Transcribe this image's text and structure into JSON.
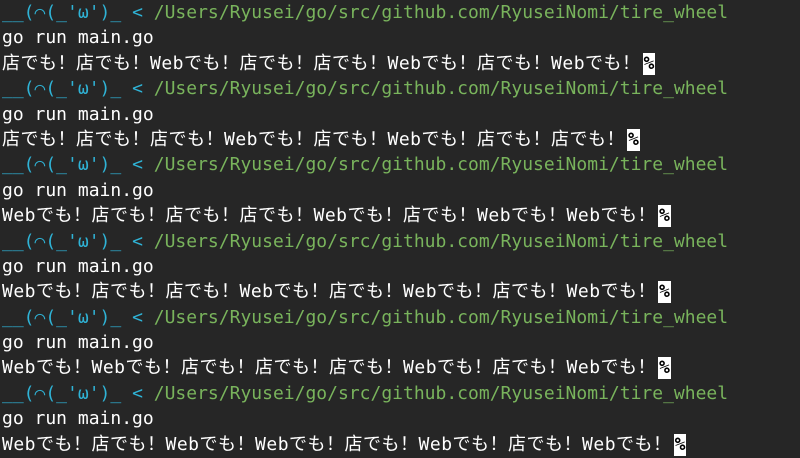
{
  "terminal": {
    "prompt_face": "__(⌒(_'ω')_",
    "prompt_arrow": "<",
    "prompt_path": "/Users/Ryusei/go/src/github.com/RyuseiNomi/tire_wheel",
    "command": "go run main.go",
    "eol_marker": "%",
    "runs": [
      {
        "output": "店でも！店でも！Webでも！店でも！店でも！Webでも！店でも！Webでも！"
      },
      {
        "output": "店でも！店でも！店でも！Webでも！店でも！Webでも！店でも！店でも！"
      },
      {
        "output": "Webでも！店でも！店でも！店でも！Webでも！店でも！Webでも！Webでも！"
      },
      {
        "output": "Webでも！店でも！店でも！Webでも！店でも！Webでも！店でも！Webでも！"
      },
      {
        "output": "Webでも！Webでも！店でも！店でも！店でも！Webでも！店でも！Webでも！"
      },
      {
        "output": "Webでも！店でも！Webでも！Webでも！店でも！Webでも！店でも！Webでも！"
      }
    ]
  },
  "colors": {
    "background": "#262626",
    "prompt_face": "#2fb3d6",
    "prompt_path": "#79b45c",
    "text": "#ffffff"
  }
}
